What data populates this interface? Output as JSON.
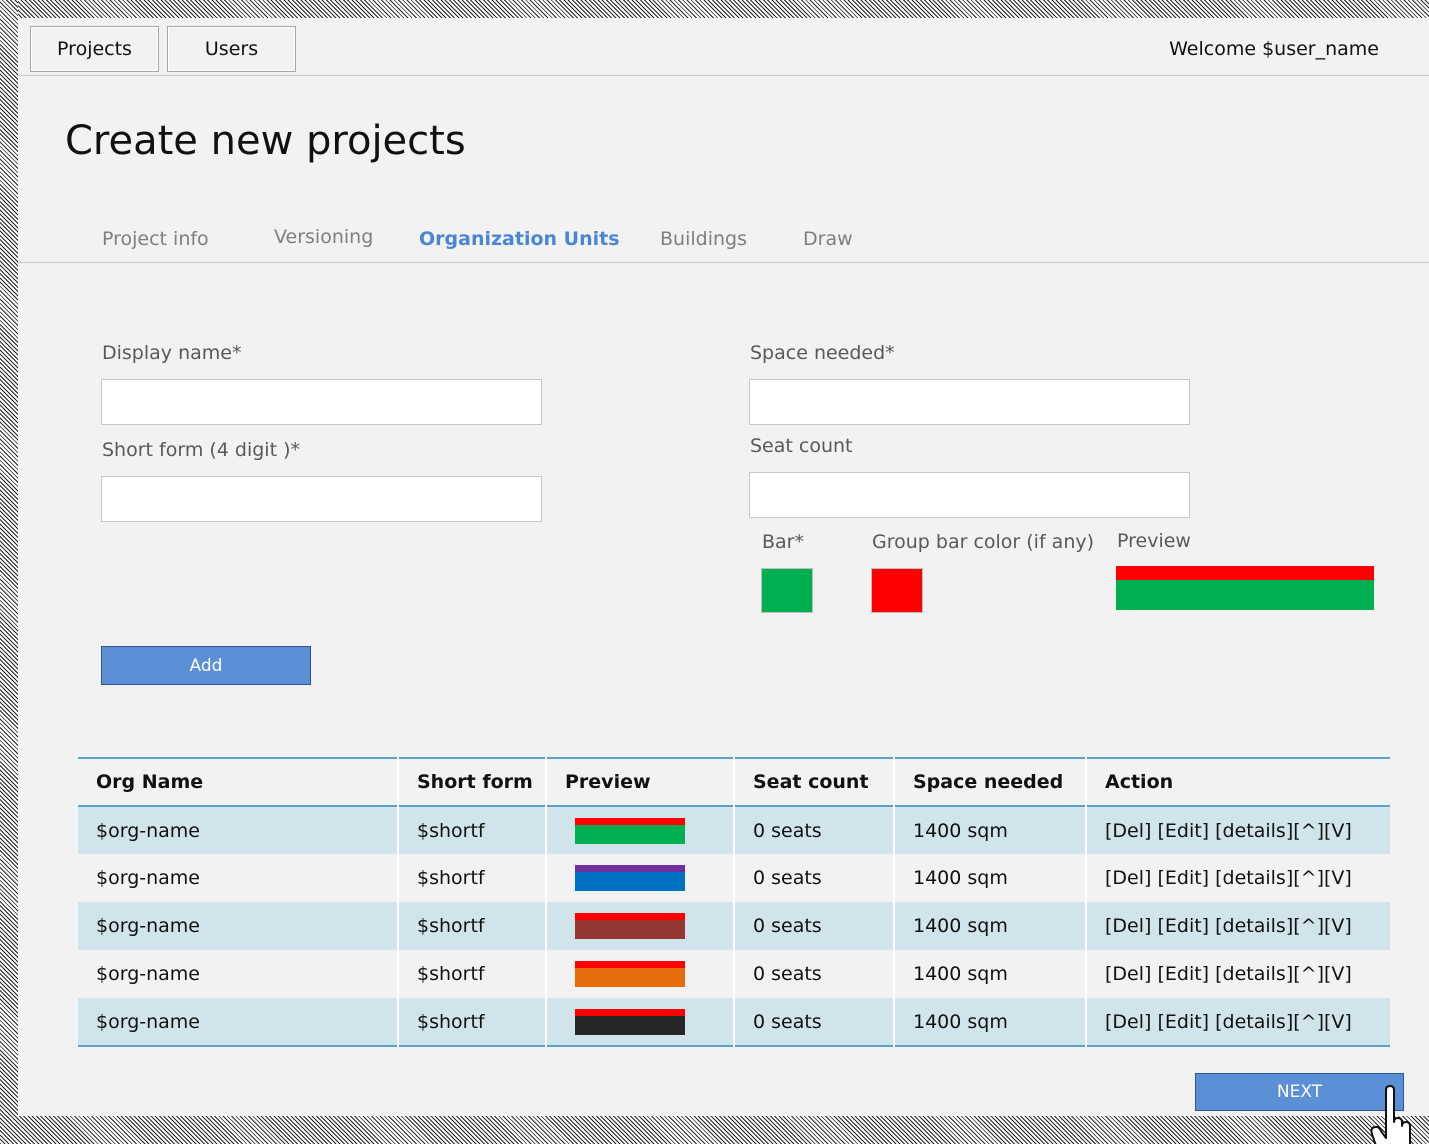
{
  "nav": {
    "projects_label": "Projects",
    "users_label": "Users",
    "welcome_text": "Welcome $user_name"
  },
  "page_title": "Create new projects",
  "tabs": [
    {
      "label": "Project info",
      "active": false
    },
    {
      "label": "Versioning",
      "active": false
    },
    {
      "label": "Organization Units",
      "active": true
    },
    {
      "label": "Buildings",
      "active": false
    },
    {
      "label": "Draw",
      "active": false
    }
  ],
  "form": {
    "display_name_label": "Display name*",
    "display_name_value": "",
    "short_form_label": "Short form (4 digit )*",
    "short_form_value": "",
    "space_needed_label": "Space needed*",
    "space_needed_value": "",
    "seat_count_label": "Seat count",
    "seat_count_value": "",
    "bar_label": "Bar*",
    "bar_color": "#00b050",
    "group_bar_label": "Group bar color (if any)",
    "group_bar_color": "#ff0000",
    "preview_label": "Preview",
    "add_label": "Add"
  },
  "table": {
    "headers": [
      "Org Name",
      "Short form",
      "Preview",
      "Seat count",
      "Space needed",
      "Action"
    ],
    "rows": [
      {
        "org_name": "$org-name",
        "short_form": "$shortf",
        "top_color": "#ff0000",
        "bottom_color": "#00b050",
        "seat_count": "0 seats",
        "space_needed": "1400 sqm",
        "action": "[Del] [Edit] [details][^][V]"
      },
      {
        "org_name": "$org-name",
        "short_form": "$shortf",
        "top_color": "#7030a0",
        "bottom_color": "#0070c0",
        "seat_count": "0 seats",
        "space_needed": "1400 sqm",
        "action": "[Del] [Edit] [details][^][V]"
      },
      {
        "org_name": "$org-name",
        "short_form": "$shortf",
        "top_color": "#ff0000",
        "bottom_color": "#953735",
        "seat_count": "0 seats",
        "space_needed": "1400 sqm",
        "action": "[Del] [Edit] [details][^][V]"
      },
      {
        "org_name": "$org-name",
        "short_form": "$shortf",
        "top_color": "#ff0000",
        "bottom_color": "#e46c0a",
        "seat_count": "0 seats",
        "space_needed": "1400 sqm",
        "action": "[Del] [Edit] [details][^][V]"
      },
      {
        "org_name": "$org-name",
        "short_form": "$shortf",
        "top_color": "#ff0000",
        "bottom_color": "#262626",
        "seat_count": "0 seats",
        "space_needed": "1400 sqm",
        "action": "[Del] [Edit] [details][^][V]"
      }
    ]
  },
  "next_label": "NEXT",
  "colors": {
    "accent": "#4a86d4",
    "button": "#5b8fd6",
    "table_border": "#5ba3c7",
    "row_stripe": "#d2e4eb"
  }
}
